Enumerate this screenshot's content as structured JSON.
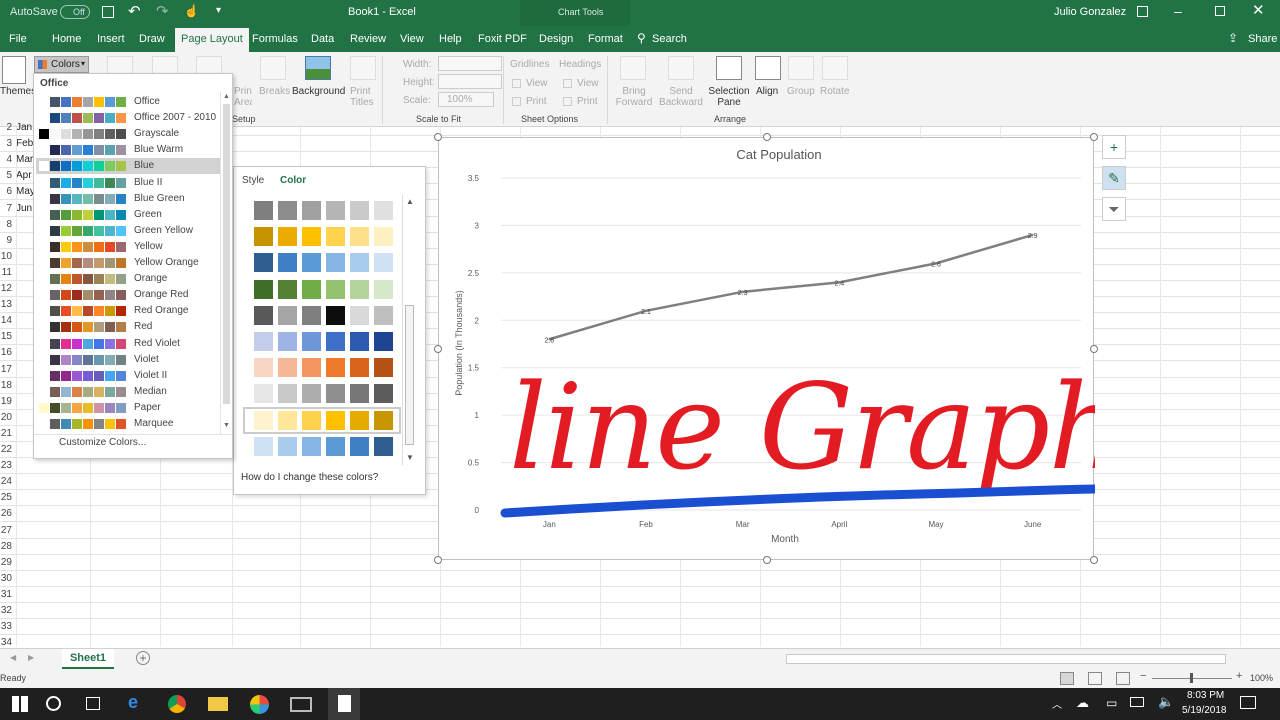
{
  "titlebar": {
    "autosave": "AutoSave",
    "autosave_state": "Off",
    "doc_title": "Book1  -  Excel",
    "context": "Chart Tools",
    "user": "Julio Gonzalez"
  },
  "tabs": [
    "File",
    "Home",
    "Insert",
    "Draw",
    "Page Layout",
    "Formulas",
    "Data",
    "Review",
    "View",
    "Help",
    "Foxit PDF",
    "Design",
    "Format"
  ],
  "tabs_active": "Page Layout",
  "search": "Search",
  "share": "Share",
  "ribbon": {
    "themes": "Themes",
    "colors": "Colors",
    "print_area": "Print Area",
    "breaks": "Breaks",
    "background": "Background",
    "print_titles": "Print Titles",
    "setup_group": "Setup",
    "width": "Width:",
    "height": "Height:",
    "scale": "Scale:",
    "scale_value": "100%",
    "scale_group": "Scale to Fit",
    "gridlines": "Gridlines",
    "headings": "Headings",
    "view": "View",
    "print": "Print",
    "sheet_options": "Sheet Options",
    "bring_forward": "Bring Forward",
    "send_backward": "Send Backward",
    "selection_pane": "Selection Pane",
    "align": "Align",
    "group": "Group",
    "rotate": "Rotate",
    "arrange": "Arrange"
  },
  "colors_menu": {
    "header": "Office",
    "items": [
      {
        "label": "Office",
        "swatches": [
          "#ffffff",
          "#44546a",
          "#4472c4",
          "#ed7d31",
          "#a5a5a5",
          "#ffc000",
          "#5b9bd5",
          "#70ad47"
        ]
      },
      {
        "label": "Office 2007 - 2010",
        "swatches": [
          "#ffffff",
          "#1f497d",
          "#4f81bd",
          "#c0504d",
          "#9bbb59",
          "#8064a2",
          "#4bacc6",
          "#f79646"
        ]
      },
      {
        "label": "Grayscale",
        "swatches": [
          "#000000",
          "#f8f8f8",
          "#dddddd",
          "#b2b2b2",
          "#969696",
          "#808080",
          "#5f5f5f",
          "#4d4d4d"
        ]
      },
      {
        "label": "Blue Warm",
        "swatches": [
          "#ffffff",
          "#242852",
          "#4a66ac",
          "#629dd1",
          "#297fd5",
          "#7f8fa9",
          "#5aa2ae",
          "#9d90a0"
        ]
      },
      {
        "label": "Blue",
        "swatches": [
          "#ffffff",
          "#17406d",
          "#0f6fc6",
          "#009dd9",
          "#0bd0d9",
          "#10cf9b",
          "#7cca62",
          "#a5c249"
        ]
      },
      {
        "label": "Blue II",
        "swatches": [
          "#ffffff",
          "#335b74",
          "#1cade4",
          "#2683c6",
          "#27ced7",
          "#42ba97",
          "#3e8853",
          "#62a39f"
        ]
      },
      {
        "label": "Blue Green",
        "swatches": [
          "#ffffff",
          "#373545",
          "#3494ba",
          "#58b6c0",
          "#75bda7",
          "#7a8c8e",
          "#84acb6",
          "#2683c6"
        ]
      },
      {
        "label": "Green",
        "swatches": [
          "#ffffff",
          "#455f51",
          "#549e39",
          "#8ab833",
          "#c0cf3a",
          "#029676",
          "#4ab5c4",
          "#0989b1"
        ]
      },
      {
        "label": "Green Yellow",
        "swatches": [
          "#ffffff",
          "#2c3c43",
          "#99cb38",
          "#63a537",
          "#37a76f",
          "#44c1a3",
          "#4eb3cf",
          "#51c3f9"
        ]
      },
      {
        "label": "Yellow",
        "swatches": [
          "#ffffff",
          "#39302a",
          "#ffca08",
          "#f8931d",
          "#ce8d3e",
          "#ec7016",
          "#e64823",
          "#9c6a6a"
        ]
      },
      {
        "label": "Yellow Orange",
        "swatches": [
          "#ffffff",
          "#4e3b30",
          "#f0a22e",
          "#a5644e",
          "#b58b80",
          "#c3986d",
          "#a19574",
          "#c17529"
        ]
      },
      {
        "label": "Orange",
        "swatches": [
          "#ffffff",
          "#637052",
          "#e48312",
          "#bd582c",
          "#865640",
          "#9b8357",
          "#c2bc80",
          "#94a088"
        ]
      },
      {
        "label": "Orange Red",
        "swatches": [
          "#ffffff",
          "#696464",
          "#d34817",
          "#9b2d1f",
          "#a28e6a",
          "#956251",
          "#918485",
          "#855d5d"
        ]
      },
      {
        "label": "Red Orange",
        "swatches": [
          "#ffffff",
          "#505046",
          "#e84c22",
          "#ffbd47",
          "#b64926",
          "#ff8427",
          "#cc9900",
          "#b22600"
        ]
      },
      {
        "label": "Red",
        "swatches": [
          "#ffffff",
          "#323232",
          "#a5300f",
          "#d55816",
          "#e19825",
          "#b19c7d",
          "#7f5f52",
          "#b27d49"
        ]
      },
      {
        "label": "Red Violet",
        "swatches": [
          "#ffffff",
          "#454551",
          "#e32d91",
          "#c830cc",
          "#4ea6dc",
          "#4775e7",
          "#8971e1",
          "#d54773"
        ]
      },
      {
        "label": "Violet",
        "swatches": [
          "#ffffff",
          "#373545",
          "#ad84c6",
          "#8784c7",
          "#5d739a",
          "#6997af",
          "#84acb6",
          "#6f8183"
        ]
      },
      {
        "label": "Violet II",
        "swatches": [
          "#ffffff",
          "#632e62",
          "#92278f",
          "#9b57d3",
          "#755dd9",
          "#665eb8",
          "#45a5ed",
          "#5982db"
        ]
      },
      {
        "label": "Median",
        "swatches": [
          "#ffffff",
          "#775f55",
          "#94b6d2",
          "#dd8047",
          "#a5ab81",
          "#d8b25c",
          "#7ba79d",
          "#968c8c"
        ]
      },
      {
        "label": "Paper",
        "swatches": [
          "#fefac9",
          "#444d26",
          "#a5b592",
          "#f3a447",
          "#e7bc29",
          "#d092a7",
          "#9c85c0",
          "#809ec2"
        ]
      },
      {
        "label": "Marquee",
        "swatches": [
          "#ffffff",
          "#5e5e5e",
          "#418ab3",
          "#a6b727",
          "#f69200",
          "#838383",
          "#fec306",
          "#df5327"
        ]
      }
    ],
    "selected": "Blue",
    "customize": "Customize Colors..."
  },
  "style_panel": {
    "tabs": [
      "Style",
      "Color"
    ],
    "active": "Color",
    "help": "How do I change these colors?",
    "rows": [
      [
        "#7f7f7f",
        "#8c8c8c",
        "#a0a0a0",
        "#b5b5b5",
        "#cacaca",
        "#e0e0e0"
      ],
      [
        "#c59200",
        "#ecab00",
        "#ffc000",
        "#ffd34d",
        "#ffe08a",
        "#fff0c2"
      ],
      [
        "#2e5e8f",
        "#3f7fc4",
        "#5b9bd5",
        "#86b6e3",
        "#a9cbec",
        "#cfe1f5"
      ],
      [
        "#3f6e26",
        "#548235",
        "#70ad47",
        "#94c36f",
        "#b3d59c",
        "#d5e8c9"
      ],
      [
        "#595959",
        "#a5a5a5",
        "#7f7f7f",
        "#0d0d0d",
        "#d9d9d9",
        "#bfbfbf"
      ],
      [
        "#c3cde9",
        "#9eb4e4",
        "#6f96d8",
        "#3d70c6",
        "#2d5bb0",
        "#204590"
      ],
      [
        "#f9d6c4",
        "#f7b796",
        "#f4965f",
        "#ef7a2b",
        "#d9641c",
        "#b45114"
      ],
      [
        "#e6e6e6",
        "#c9c9c9",
        "#adadad",
        "#8f8f8f",
        "#777777",
        "#5c5c5c"
      ],
      [
        "#fff2cc",
        "#ffe699",
        "#ffd24d",
        "#ffc000",
        "#e6ab00",
        "#c89600"
      ],
      [
        "#cfe1f5",
        "#a9cbec",
        "#86b6e3",
        "#5b9bd5",
        "#3f7fc4",
        "#2e5e8f"
      ]
    ]
  },
  "rows": [
    {
      "n": "2",
      "val": "Jan"
    },
    {
      "n": "3",
      "val": "Feb"
    },
    {
      "n": "4",
      "val": "Mar"
    },
    {
      "n": "5",
      "val": "Apr"
    },
    {
      "n": "6",
      "val": "May"
    },
    {
      "n": "7",
      "val": "Jun"
    },
    {
      "n": "8",
      "val": ""
    },
    {
      "n": "9",
      "val": ""
    },
    {
      "n": "10",
      "val": ""
    },
    {
      "n": "11",
      "val": ""
    },
    {
      "n": "12",
      "val": ""
    },
    {
      "n": "13",
      "val": ""
    },
    {
      "n": "14",
      "val": ""
    },
    {
      "n": "15",
      "val": ""
    },
    {
      "n": "16",
      "val": ""
    },
    {
      "n": "17",
      "val": ""
    },
    {
      "n": "18",
      "val": ""
    },
    {
      "n": "19",
      "val": ""
    },
    {
      "n": "20",
      "val": ""
    },
    {
      "n": "21",
      "val": ""
    },
    {
      "n": "22",
      "val": ""
    },
    {
      "n": "23",
      "val": ""
    },
    {
      "n": "24",
      "val": ""
    },
    {
      "n": "25",
      "val": ""
    },
    {
      "n": "26",
      "val": ""
    },
    {
      "n": "27",
      "val": ""
    },
    {
      "n": "28",
      "val": ""
    },
    {
      "n": "29",
      "val": ""
    },
    {
      "n": "30",
      "val": ""
    },
    {
      "n": "31",
      "val": ""
    },
    {
      "n": "32",
      "val": ""
    },
    {
      "n": "33",
      "val": ""
    },
    {
      "n": "34",
      "val": ""
    }
  ],
  "sheet_tab": "Sheet1",
  "status": {
    "ready": "Ready",
    "zoom": "100%"
  },
  "taskbar": {
    "time": "8:03 PM",
    "date": "5/19/2018"
  },
  "overlay": {
    "text": "line Graphs!",
    "color": "#e31b23",
    "underline_color": "#1a4fd1"
  },
  "chart_data": {
    "type": "line",
    "title": "Cat Population",
    "xlabel": "Month",
    "ylabel": "Population (In Thousands)",
    "categories": [
      "Jan",
      "Feb",
      "Mar",
      "April",
      "May",
      "June"
    ],
    "values": [
      1.8,
      2.1,
      2.3,
      2.4,
      2.6,
      2.9
    ],
    "data_labels": [
      "2.8",
      "2.1",
      "2.3",
      "2.4",
      "2.6",
      "2.9"
    ],
    "yticks": [
      "0",
      "0.5",
      "1",
      "1.5",
      "2",
      "2.5",
      "3",
      "3.5"
    ],
    "ylim": [
      0,
      3.5
    ],
    "line_color": "#7f7f7f",
    "grid": true
  }
}
